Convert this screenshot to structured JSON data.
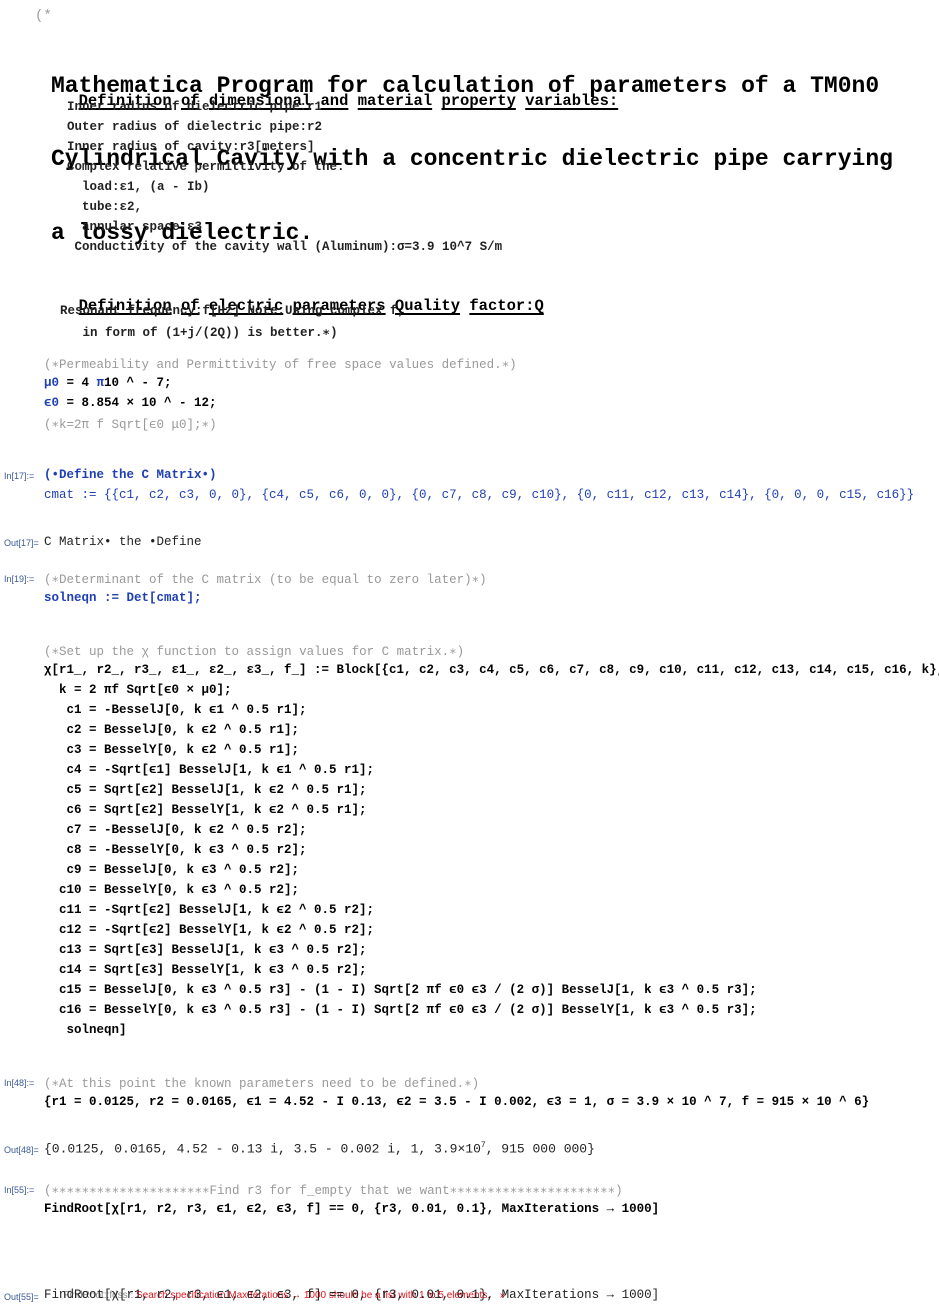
{
  "header": {
    "comment_open": "(*",
    "title_lines": [
      "Mathematica Program for calculation of parameters of a TM0n0",
      "Cylindrical Cavity with a concentric dielectric pipe carrying",
      "a lossy dielectric."
    ]
  },
  "section1": {
    "heading_words": [
      "Definition",
      "of",
      "dimensional",
      "and",
      "material",
      "property",
      "variables:"
    ],
    "lines": [
      "Inner radius of dielectric pipe:r1",
      "Outer radius of dielectric pipe:r2",
      "Inner radius of cavity:r3[meters]",
      "Complex relative permittivity of the:",
      "  load:ε1, (a - Ib)",
      "  tube:ε2,",
      "  annular space:ε3",
      " Conductivity of the cavity wall (Aluminum):σ=3.9 10^7 S/m"
    ]
  },
  "section2": {
    "heading_words": [
      "Definition",
      "of",
      "electric",
      "parameters",
      "Quality",
      "factor:Q"
    ],
    "lines": [
      "Resonant frequency:f[Hz] Note.Using complex f,",
      "   in form of (1+j/(2Q)) is better.∗)"
    ]
  },
  "constants": {
    "comment": "(∗Permeability and Permittivity of free space values defined.∗)",
    "mu0_name": "μ0",
    "mu0_rest": " = 4 ",
    "mu0_pi": "π",
    "mu0_tail": "10 ^ - 7;",
    "eps0_name": "ϵ0",
    "eps0_rest": " = 8.854 × 10 ^ - 12;",
    "k_comment": "(∗k=2π f Sqrt[ϵ0 μ0];∗)"
  },
  "cells": {
    "in17": {
      "label": "In[17]:=",
      "line1": "(•Define the C Matrix•)",
      "line2": "cmat := {{c1, c2, c3, 0, 0}, {c4, c5, c6, 0, 0}, {0, c7, c8, c9, c10}, {0, c11, c12, c13, c14}, {0, 0, 0, c15, c16}}"
    },
    "out17": {
      "label": "Out[17]=",
      "value": "C Matrix• the •Define"
    },
    "in19": {
      "label": "In[19]:=",
      "comment": "(∗Determinant of the C matrix (to be equal to zero later)∗)",
      "code": "solneqn := Det[cmat];"
    },
    "chi": {
      "comment": "(∗Set up the χ function to assign values for C matrix.∗)",
      "header": "χ[r1_, r2_, r3_, ε1_, ε2_, ε3_, f_] := Block[{c1, c2, c3, c4, c5, c6, c7, c8, c9, c10, c11, c12, c13, c14, c15, c16, k},",
      "lines": [
        "  k = 2 πf Sqrt[ϵ0 × μ0];",
        "   c1 = -BesselJ[0, k ϵ1 ^ 0.5 r1];",
        "   c2 = BesselJ[0, k ϵ2 ^ 0.5 r1];",
        "   c3 = BesselY[0, k ϵ2 ^ 0.5 r1];",
        "   c4 = -Sqrt[ϵ1] BesselJ[1, k ϵ1 ^ 0.5 r1];",
        "   c5 = Sqrt[ϵ2] BesselJ[1, k ϵ2 ^ 0.5 r1];",
        "   c6 = Sqrt[ϵ2] BesselY[1, k ϵ2 ^ 0.5 r1];",
        "   c7 = -BesselJ[0, k ϵ2 ^ 0.5 r2];",
        "   c8 = -BesselY[0, k ϵ3 ^ 0.5 r2];",
        "   c9 = BesselJ[0, k ϵ3 ^ 0.5 r2];",
        "  c10 = BesselY[0, k ϵ3 ^ 0.5 r2];",
        "  c11 = -Sqrt[ϵ2] BesselJ[1, k ϵ2 ^ 0.5 r2];",
        "  c12 = -Sqrt[ϵ2] BesselY[1, k ϵ2 ^ 0.5 r2];",
        "  c13 = Sqrt[ϵ3] BesselJ[1, k ϵ3 ^ 0.5 r2];",
        "  c14 = Sqrt[ϵ3] BesselY[1, k ϵ3 ^ 0.5 r2];",
        "  c15 = BesselJ[0, k ϵ3 ^ 0.5 r3] - (1 - I) Sqrt[2 πf ϵ0 ϵ3 / (2 σ)] BesselJ[1, k ϵ3 ^ 0.5 r3];",
        "  c16 = BesselY[0, k ϵ3 ^ 0.5 r3] - (1 - I) Sqrt[2 πf ϵ0 ϵ3 / (2 σ)] BesselY[1, k ϵ3 ^ 0.5 r3];",
        "   solneqn]"
      ]
    },
    "in48": {
      "label": "In[48]:=",
      "comment": "(∗At this point the known parameters need to be defined.∗)",
      "code": "{r1 = 0.0125, r2 = 0.0165, ϵ1 = 4.52 - I 0.13, ϵ2 = 3.5 - I 0.002, ϵ3 = 1, σ = 3.9 × 10 ^ 7, f = 915 × 10 ^ 6}"
    },
    "out48": {
      "label": "Out[48]=",
      "value_pre": "{0.0125, 0.0165, 4.52 - 0.13 i, 3.5 - 0.002 i, 1, 3.9×10",
      "value_sup": "7",
      "value_post": ", 915 000 000}"
    },
    "in55": {
      "label": "In[55]:=",
      "comment": "(∗∗∗∗∗∗∗∗∗∗∗∗∗∗∗∗∗∗∗∗∗Find r3 for f_empty that we want∗∗∗∗∗∗∗∗∗∗∗∗∗∗∗∗∗∗∗∗∗∗)",
      "code": "FindRoot[χ[r1, r2, r3, ϵ1, ϵ2, ϵ3, f] == 0, {r3, 0.01, 0.1}, MaxIterations → 1000]"
    },
    "message": {
      "source": "FindRoot::fdss : ",
      "text": "Search specification MaxIterations → 1000 should be a list with 1 to 5 elements.",
      "more_link": "»"
    },
    "out55": {
      "label": "Out[55]=",
      "value": "FindRoot[χ[r1, r2, r3, ϵ1, ϵ2, ϵ3, f] == 0, {r3, 0.01, 0.1}, MaxIterations → 1000]"
    }
  }
}
